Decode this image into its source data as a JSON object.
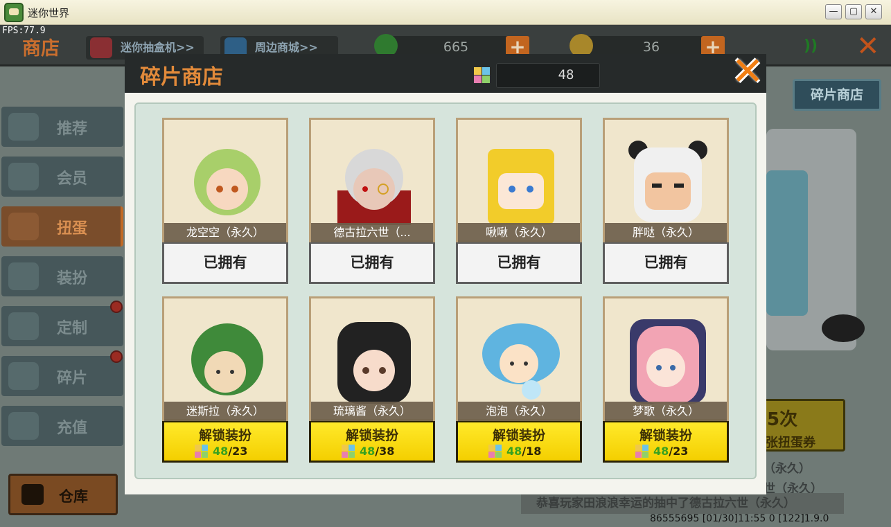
{
  "window": {
    "title": "迷你世界",
    "fps": "FPS:77.9",
    "minimize": "—",
    "maximize": "▢",
    "close": "✕"
  },
  "topbar": {
    "shop_title": "商店",
    "gacha_link": "迷你抽盒机>>",
    "merch_link": "周边商城>>",
    "mini_beans": "665",
    "mini_coins": "36"
  },
  "sidebar": {
    "items": [
      {
        "label": "推荐"
      },
      {
        "label": "会员"
      },
      {
        "label": "扭蛋"
      },
      {
        "label": "装扮"
      },
      {
        "label": "定制"
      },
      {
        "label": "碎片"
      },
      {
        "label": "充值"
      }
    ],
    "storage": "仓库"
  },
  "background": {
    "fragment_shop_button": "碎片商店",
    "roll_count": "5次",
    "roll_ticket": "张扭蛋券",
    "bg_line_1": "（永久）",
    "bg_line_2": "世（永久）",
    "news": "恭喜玩家田浪浪幸运的抽中了德古拉六世（永久）",
    "footer": "86555695    [01/30]11:55 0    [122]1.9.0"
  },
  "modal": {
    "title": "碎片商店",
    "fragment_count": "48",
    "cards": [
      {
        "name": "龙空空（永久）",
        "status": "owned",
        "button": "已拥有",
        "accent": "#a8cf6a"
      },
      {
        "name": "德古拉六世（...",
        "status": "owned",
        "button": "已拥有",
        "accent": "#d8d8d8"
      },
      {
        "name": "啾啾（永久）",
        "status": "owned",
        "button": "已拥有",
        "accent": "#f2cc2a"
      },
      {
        "name": "胖哒（永久）",
        "status": "owned",
        "button": "已拥有",
        "accent": "#f0f0f0"
      },
      {
        "name": "迷斯拉（永久）",
        "status": "unlock",
        "button": "解锁装扮",
        "have": "48",
        "cost": "23",
        "accent": "#3f8a3a"
      },
      {
        "name": "琉璃酱（永久）",
        "status": "unlock",
        "button": "解锁装扮",
        "have": "48",
        "cost": "38",
        "accent": "#222222"
      },
      {
        "name": "泡泡（永久）",
        "status": "unlock",
        "button": "解锁装扮",
        "have": "48",
        "cost": "18",
        "accent": "#5fb4e0"
      },
      {
        "name": "梦歌（永久）",
        "status": "unlock",
        "button": "解锁装扮",
        "have": "48",
        "cost": "23",
        "accent": "#f2a4b4"
      }
    ]
  },
  "colors": {
    "accent_orange": "#e28a3a",
    "unlock_yellow": "#ffe92a",
    "have_green": "#38a11f"
  }
}
